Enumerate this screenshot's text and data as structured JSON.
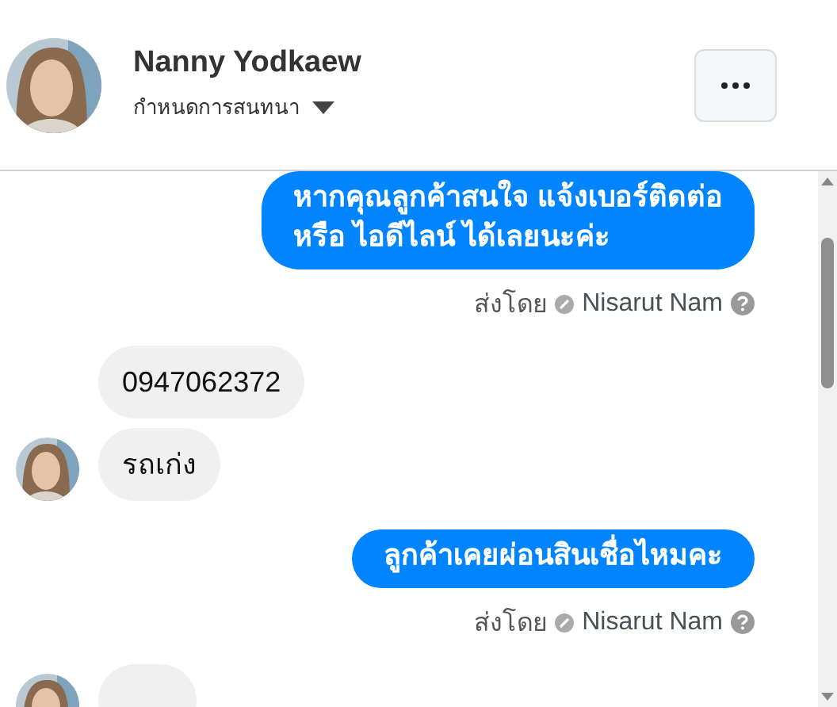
{
  "header": {
    "name": "Nanny Yodkaew",
    "subtitle": "กำหนดการสนทนา"
  },
  "messages": [
    {
      "kind": "outgoing",
      "lines": [
        "หากคุณลูกค้าสนใจ แจ้งเบอร์ติดต่อ",
        "หรือ ไอดีไลน์ ได้เลยนะค่ะ"
      ],
      "sent_by_label": "ส่งโดย",
      "sender": "Nisarut Nam"
    },
    {
      "kind": "incoming",
      "lines": [
        "0947062372"
      ],
      "avatar": false
    },
    {
      "kind": "incoming",
      "lines": [
        "รถเก่ง"
      ],
      "avatar": true
    },
    {
      "kind": "outgoing",
      "lines": [
        "ลูกค้าเคยผ่อนสินเชื่อไหมคะ"
      ],
      "sent_by_label": "ส่งโดย",
      "sender": "Nisarut Nam"
    },
    {
      "kind": "incoming",
      "avatar": true
    }
  ]
}
